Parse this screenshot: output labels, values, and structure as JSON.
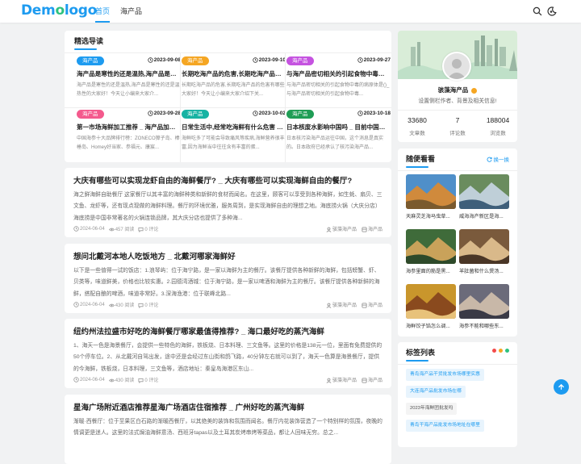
{
  "header": {
    "logo": "Demologo",
    "nav": [
      {
        "label": "首页",
        "active": true
      },
      {
        "label": "海产品",
        "active": false
      }
    ],
    "icons": [
      "search-icon",
      "theme-toggle-icon"
    ]
  },
  "featured": {
    "title": "精选导读",
    "items": [
      {
        "tag": "海产品",
        "tag_color": "#1d9bf0",
        "date": "2023-09-08",
        "title": "海产品是寒性的还是温热,海产品是寒性的...",
        "desc": "海产品是寒性的还是温热,海产品是寒性的还是温热性的大家好！今天让小编来大家介..."
      },
      {
        "tag": "海产品",
        "tag_color": "#f5a623",
        "date": "2023-09-10",
        "title": "长期吃海产品的危害,长期吃海产品的危害...",
        "desc": "长期吃海产品的危害,长期吃海产品的危害有哪些大家好！今天让小编来大家介绍下关..."
      },
      {
        "tag": "海产品",
        "tag_color": "#c553e0",
        "date": "2023-09-27",
        "title": "与海产品密切相关的引起食物中毒的病原体...",
        "desc": "与海产品密切相关的引起食物中毒的病原体是()_与海产品密切相关的引起食物中毒..."
      },
      {
        "tag": "海产品",
        "tag_color": "#f45a8d",
        "date": "2023-09-28",
        "title": "第一市场海鲜加工推荐 _ 海产品加工厂",
        "desc": "中国海参十大品牌排行榜：ZONECO獐子岛、棒棰岛、Homey好当家、参福元、康宸..."
      },
      {
        "tag": "海产品",
        "tag_color": "#17b3a3",
        "date": "2023-10-02",
        "title": "日常生活中,经常吃海鲜有什么危害 _ 吃...",
        "desc": "海鲜吃多了可能会导致痛风等疾病,海鲜营养很丰富,因为海鲜当中往往含有丰富的蛋..."
      },
      {
        "tag": "海产品",
        "tag_color": "#1f9d55",
        "date": "2023-10-18",
        "title": "日本核废水影响中国吗 _ 目前中国的海产...",
        "desc": "日本核污染海产品运往中国，这个消息是真实的。日本政府已经承认了核污染海产品..."
      }
    ]
  },
  "posts": [
    {
      "title": "大庆有哪些可以实现龙虾自由的海鲜餐厅? _ 大庆有哪些可以实现海鲜自由的餐厅?",
      "excerpt": "海之鲜海鲜自助餐厅 这家餐厅以其丰富的海鲜种类和新鲜的食材而闻名。在这里，顾客可以享受到各种海鲜，如生蚝、扇贝、三文鱼、龙虾等，还有现点现做的海鲜料理。餐厅的环境优雅，服务周到，是实现海鲜自由的理想之地。海底捞火锅（大庆分店） 海底捞是中国非常著名的火锅连锁品牌，其大庆分店也提供了多种海...",
      "date": "2024-06-04",
      "views": "457 阅读",
      "comments": "0 评论",
      "author": "骇藻海产品",
      "category": "海产品"
    },
    {
      "title": "想问北戴河本地人吃饭地方 _ 北戴河哪家海鲜好",
      "excerpt": "以下是一些值得一试的饭店：1.浪琴屿：位于海宁路，是一家以海鲜为主的餐厅。该餐厅提供各种新鲜的海鲜，包括螃蟹、虾、贝类等，味道鲜美，价格也比较实惠。2.园德湾酒城：位于海宁路，是一家以啤酒和海鲜为主的餐厅。该餐厅提供各种新鲜的海鲜，搭配自酿的啤酒，味道非常好。3.深海渔港：位于联峰北路...",
      "date": "2024-06-04",
      "views": "430 阅读",
      "comments": "0 评论",
      "author": "骇藻海产品",
      "category": "海产品"
    },
    {
      "title": "纽约州法拉盛市好吃的海鲜餐厅哪家最值得推荐? _ 海口最好吃的蒸汽海鲜",
      "excerpt": "1、海天一色是海景餐厅，会提供一些特色的海鲜，铁板烧、日本料理、三文鱼等。这里的价格是138元一位，里面有免费提供的50个停车位。2、从北戴河自驾出发，途中还是会经过东山街和鸽飞路，40分钟左右就可以到了，海天一色算是海景餐厅，提供的今海鲜，铁板烧，日本料理，三文鱼等，酒店地址：秦皇岛海港区东山...",
      "date": "2024-06-04",
      "views": "430 阅读",
      "comments": "0 评论",
      "author": "骇藻海产品",
      "category": "海产品"
    },
    {
      "title": "星海广场附近酒店推荐星海广场酒店住宿推荐 _ 广州好吃的蒸汽海鲜",
      "excerpt": "渐暖·西餐厅：位于至果区白石路的渐暖西餐厅，以其绝美的装饰和氛围而闻名。餐厅内花装饰营造了一个特别样的氛围，夜晚的情调更是迷人。这里的法式焗油海鲜意汤、西班牙tapas以及土耳其炭烤串烤等菜品，都让人回味无穷。总之..."
    }
  ],
  "profile": {
    "name": "骇藻海产品",
    "bio": "设置侧栏作者、背景及相关信息!",
    "stats": [
      {
        "value": "33680",
        "label": "文章数"
      },
      {
        "value": "7",
        "label": "评论数"
      },
      {
        "value": "188004",
        "label": "浏览数"
      }
    ]
  },
  "random": {
    "title": "随便看看",
    "action": "换一换",
    "items": [
      "天麻灵芝海马虫草...",
      "威海海产新区是海...",
      "海参里面的筋是黑...",
      "羊肚菌和什么煲汤...",
      "海鲜饺子馅怎么调...",
      "海参不能和哪些东..."
    ]
  },
  "tags": {
    "title": "标签列表",
    "items": [
      "青岛海产品干货批发市场哪里实惠",
      "大连海产品批发市场在哪",
      "2023年海鲜团批发吗",
      "青岛干海产品批发市场地址在哪里"
    ]
  },
  "colors": {
    "accent": "#1d9bf0",
    "dots": [
      "#f44a4a",
      "#f5a623",
      "#2ec27e"
    ]
  }
}
